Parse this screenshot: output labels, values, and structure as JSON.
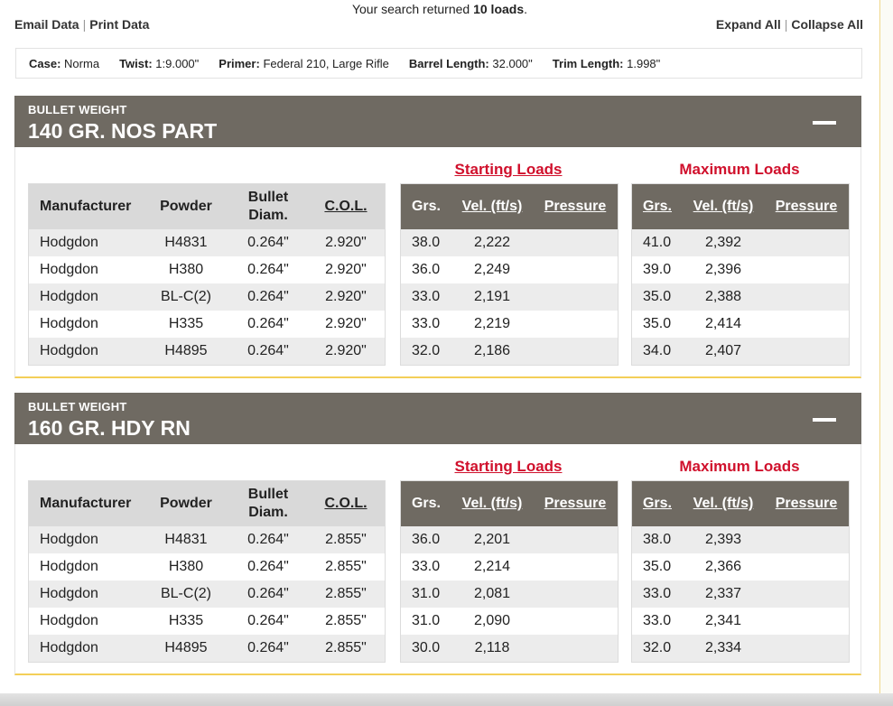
{
  "top": {
    "email_label": "Email Data",
    "print_label": "Print Data",
    "result_prefix": "Your search returned ",
    "result_count": "10 loads",
    "result_suffix": ".",
    "expand_label": "Expand All",
    "collapse_label": "Collapse All"
  },
  "info": {
    "case_label": "Case:",
    "case_value": "Norma",
    "twist_label": "Twist:",
    "twist_value": "1:9.000\"",
    "primer_label": "Primer:",
    "primer_value": "Federal 210, Large Rifle",
    "barrel_label": "Barrel Length:",
    "barrel_value": "32.000\"",
    "trim_label": "Trim Length:",
    "trim_value": "1.998\""
  },
  "headers": {
    "manufacturer": "Manufacturer",
    "powder": "Powder",
    "bullet_diam_1": "Bullet",
    "bullet_diam_2": "Diam.",
    "col": "C.O.L.",
    "grs": "Grs.",
    "vel": "Vel. (ft/s)",
    "pressure": "Pressure",
    "starting": "Starting Loads",
    "maximum": "Maximum Loads"
  },
  "sections": [
    {
      "bw_label": "BULLET WEIGHT",
      "name": "140 GR. NOS PART",
      "rows": [
        {
          "manufacturer": "Hodgdon",
          "powder": "H4831",
          "diam": "0.264\"",
          "col": "2.920\"",
          "s_grs": "38.0",
          "s_vel": "2,222",
          "s_press": "",
          "m_grs": "41.0",
          "m_vel": "2,392",
          "m_press": ""
        },
        {
          "manufacturer": "Hodgdon",
          "powder": "H380",
          "diam": "0.264\"",
          "col": "2.920\"",
          "s_grs": "36.0",
          "s_vel": "2,249",
          "s_press": "",
          "m_grs": "39.0",
          "m_vel": "2,396",
          "m_press": ""
        },
        {
          "manufacturer": "Hodgdon",
          "powder": "BL-C(2)",
          "diam": "0.264\"",
          "col": "2.920\"",
          "s_grs": "33.0",
          "s_vel": "2,191",
          "s_press": "",
          "m_grs": "35.0",
          "m_vel": "2,388",
          "m_press": ""
        },
        {
          "manufacturer": "Hodgdon",
          "powder": "H335",
          "diam": "0.264\"",
          "col": "2.920\"",
          "s_grs": "33.0",
          "s_vel": "2,219",
          "s_press": "",
          "m_grs": "35.0",
          "m_vel": "2,414",
          "m_press": ""
        },
        {
          "manufacturer": "Hodgdon",
          "powder": "H4895",
          "diam": "0.264\"",
          "col": "2.920\"",
          "s_grs": "32.0",
          "s_vel": "2,186",
          "s_press": "",
          "m_grs": "34.0",
          "m_vel": "2,407",
          "m_press": ""
        }
      ]
    },
    {
      "bw_label": "BULLET WEIGHT",
      "name": "160 GR. HDY RN",
      "rows": [
        {
          "manufacturer": "Hodgdon",
          "powder": "H4831",
          "diam": "0.264\"",
          "col": "2.855\"",
          "s_grs": "36.0",
          "s_vel": "2,201",
          "s_press": "",
          "m_grs": "38.0",
          "m_vel": "2,393",
          "m_press": ""
        },
        {
          "manufacturer": "Hodgdon",
          "powder": "H380",
          "diam": "0.264\"",
          "col": "2.855\"",
          "s_grs": "33.0",
          "s_vel": "2,214",
          "s_press": "",
          "m_grs": "35.0",
          "m_vel": "2,366",
          "m_press": ""
        },
        {
          "manufacturer": "Hodgdon",
          "powder": "BL-C(2)",
          "diam": "0.264\"",
          "col": "2.855\"",
          "s_grs": "31.0",
          "s_vel": "2,081",
          "s_press": "",
          "m_grs": "33.0",
          "m_vel": "2,337",
          "m_press": ""
        },
        {
          "manufacturer": "Hodgdon",
          "powder": "H335",
          "diam": "0.264\"",
          "col": "2.855\"",
          "s_grs": "31.0",
          "s_vel": "2,090",
          "s_press": "",
          "m_grs": "33.0",
          "m_vel": "2,341",
          "m_press": ""
        },
        {
          "manufacturer": "Hodgdon",
          "powder": "H4895",
          "diam": "0.264\"",
          "col": "2.855\"",
          "s_grs": "30.0",
          "s_vel": "2,118",
          "s_press": "",
          "m_grs": "32.0",
          "m_vel": "2,334",
          "m_press": ""
        }
      ]
    }
  ],
  "colors": {
    "header_bg": "#6f6a62",
    "accent_red": "#d0102c",
    "separator_gold": "#f3cf58"
  }
}
